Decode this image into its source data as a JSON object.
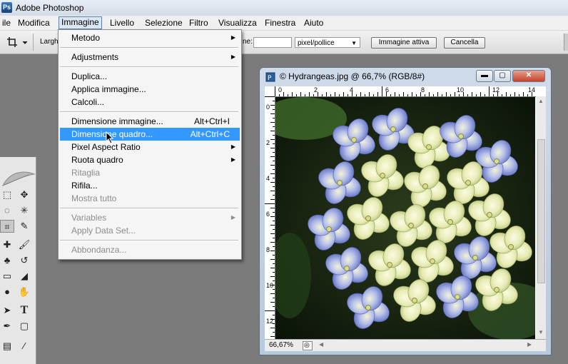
{
  "window": {
    "title": "Adobe Photoshop",
    "app_icon": "Ps"
  },
  "menubar": [
    {
      "label": "ile"
    },
    {
      "label": "Modifica"
    },
    {
      "label": "Immagine",
      "active": true
    },
    {
      "label": "Livello"
    },
    {
      "label": "Selezione"
    },
    {
      "label": "Filtro"
    },
    {
      "label": "Visualizza"
    },
    {
      "label": "Finestra"
    },
    {
      "label": "Aiuto"
    }
  ],
  "options_bar": {
    "tool_icon": "crop-icon",
    "width_label": "Largh",
    "resolution_label_fragment": "ne:",
    "resolution_value": "",
    "unit_select": "pixel/pollice",
    "front_image_button": "Immagine attiva",
    "clear_button": "Cancella"
  },
  "image_menu": {
    "items": [
      {
        "label": "Metodo",
        "submenu": true
      },
      {
        "label": "Adjustments",
        "submenu": true
      },
      {
        "label": "Duplica..."
      },
      {
        "label": "Applica immagine..."
      },
      {
        "label": "Calcoli..."
      },
      {
        "label": "Dimensione immagine...",
        "shortcut": "Alt+Ctrl+I"
      },
      {
        "label": "Dimensione quadro...",
        "shortcut": "Alt+Ctrl+C",
        "highlighted": true
      },
      {
        "label": "Pixel Aspect Ratio",
        "submenu": true
      },
      {
        "label": "Ruota quadro",
        "submenu": true
      },
      {
        "label": "Ritaglia",
        "disabled": true
      },
      {
        "label": "Rifila..."
      },
      {
        "label": "Mostra tutto",
        "disabled": true
      },
      {
        "label": "Variables",
        "submenu": true,
        "disabled": true
      },
      {
        "label": "Apply Data Set...",
        "disabled": true
      },
      {
        "label": "Abbondanza...",
        "disabled": true
      }
    ]
  },
  "document": {
    "title": "© Hydrangeas.jpg @ 66,7% (RGB/8#)",
    "zoom_status": "66,67%",
    "ruler_h": [
      "0",
      "2",
      "4",
      "6",
      "8",
      "10",
      "12",
      "14"
    ],
    "ruler_v": [
      "0",
      "2",
      "4",
      "6",
      "8",
      "10",
      "12"
    ],
    "minimize_button": "▬",
    "maximize_button": "▢",
    "close_button": "✕"
  },
  "toolbox": {
    "tools": [
      {
        "name": "marquee-icon",
        "glyph": "⬚"
      },
      {
        "name": "move-icon",
        "glyph": "✥"
      },
      {
        "name": "lasso-icon",
        "glyph": "◌"
      },
      {
        "name": "magic-wand-icon",
        "glyph": "✳"
      },
      {
        "name": "crop-icon",
        "glyph": "⌗"
      },
      {
        "name": "slice-icon",
        "glyph": "✎"
      },
      {
        "name": "healing-brush-icon",
        "glyph": "✚"
      },
      {
        "name": "brush-icon",
        "glyph": "🖌"
      },
      {
        "name": "clone-stamp-icon",
        "glyph": "♣"
      },
      {
        "name": "history-brush-icon",
        "glyph": "↺"
      },
      {
        "name": "eraser-icon",
        "glyph": "▭"
      },
      {
        "name": "bucket-icon",
        "glyph": "◢"
      },
      {
        "name": "blur-icon",
        "glyph": "●"
      },
      {
        "name": "dodge-icon",
        "glyph": "✋"
      },
      {
        "name": "path-selection-icon",
        "glyph": "➤"
      },
      {
        "name": "type-icon",
        "glyph": "T"
      },
      {
        "name": "pen-icon",
        "glyph": "✒"
      },
      {
        "name": "shape-icon",
        "glyph": "▢"
      },
      {
        "name": "notes-icon",
        "glyph": "▤"
      },
      {
        "name": "eyedropper-icon",
        "glyph": "⁄"
      }
    ]
  },
  "colors": {
    "highlight": "#3399ff",
    "menu_bg": "#f5f5f5",
    "workspace": "#7b7b7b"
  }
}
